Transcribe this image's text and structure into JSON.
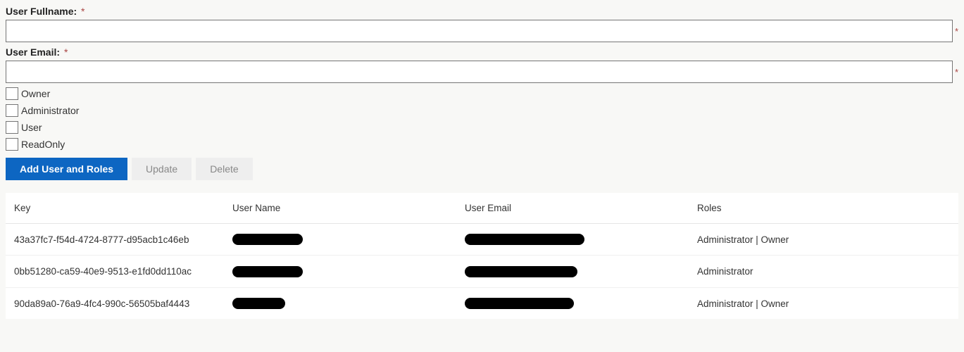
{
  "form": {
    "fullname_label": "User Fullname:",
    "fullname_value": "",
    "email_label": "User Email:",
    "email_value": "",
    "required_mark": "*"
  },
  "roles": {
    "owner": "Owner",
    "administrator": "Administrator",
    "user": "User",
    "readonly": "ReadOnly"
  },
  "buttons": {
    "add": "Add User and Roles",
    "update": "Update",
    "delete": "Delete"
  },
  "table": {
    "headers": {
      "key": "Key",
      "name": "User Name",
      "email": "User Email",
      "roles": "Roles"
    },
    "rows": [
      {
        "key": "43a37fc7-f54d-4724-8777-d95acb1c46eb",
        "roles": "Administrator | Owner"
      },
      {
        "key": "0bb51280-ca59-40e9-9513-e1fd0dd110ac",
        "roles": "Administrator"
      },
      {
        "key": "90da89a0-76a9-4fc4-990c-56505baf4443",
        "roles": "Administrator | Owner"
      }
    ]
  }
}
